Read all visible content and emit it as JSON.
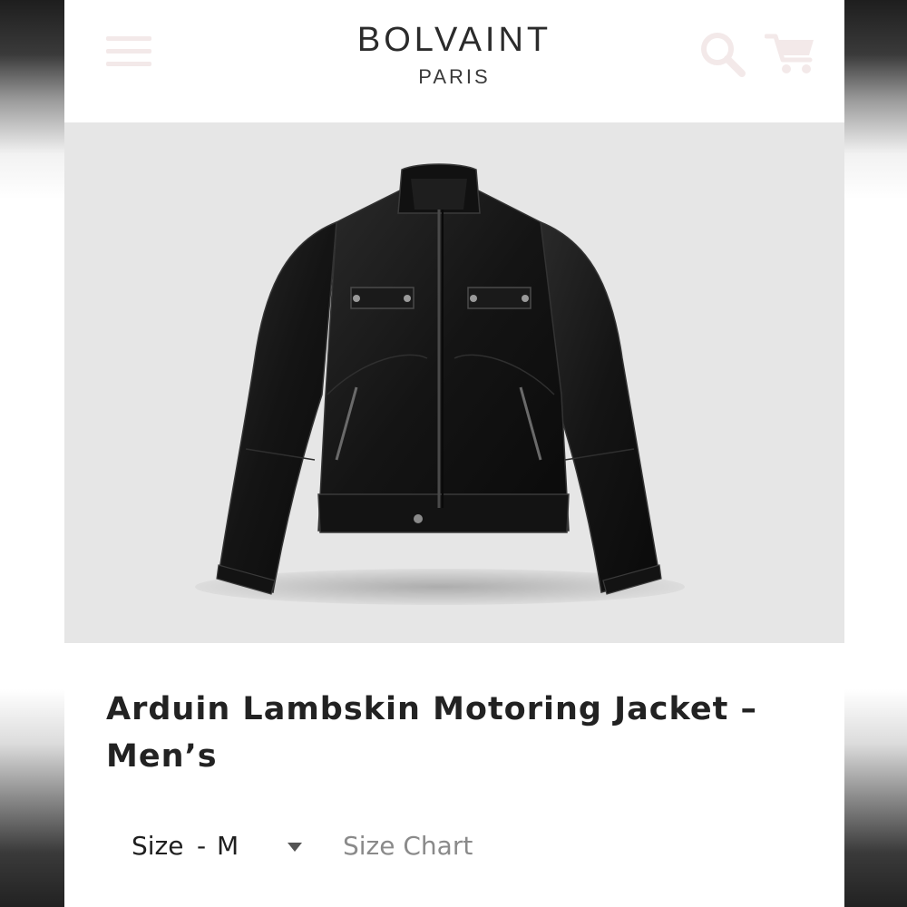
{
  "header": {
    "brand_name": "BOLVAINT",
    "brand_sub": "PARIS",
    "icons": {
      "menu": "hamburger-menu-icon",
      "search": "search-icon",
      "cart": "cart-icon"
    },
    "icon_color": "#f3e9e9"
  },
  "product": {
    "image_alt": "black leather motoring jacket",
    "title_line1": "Arduin Lambskin Motoring Jacket –",
    "title_line2": "Men’s",
    "size_label": "Size",
    "size_separator": "-",
    "size_value": "M",
    "size_chart_label": "Size Chart"
  },
  "colors": {
    "hero_background": "#e6e6e6",
    "text": "#222222",
    "muted_link": "#8a8a8a"
  }
}
